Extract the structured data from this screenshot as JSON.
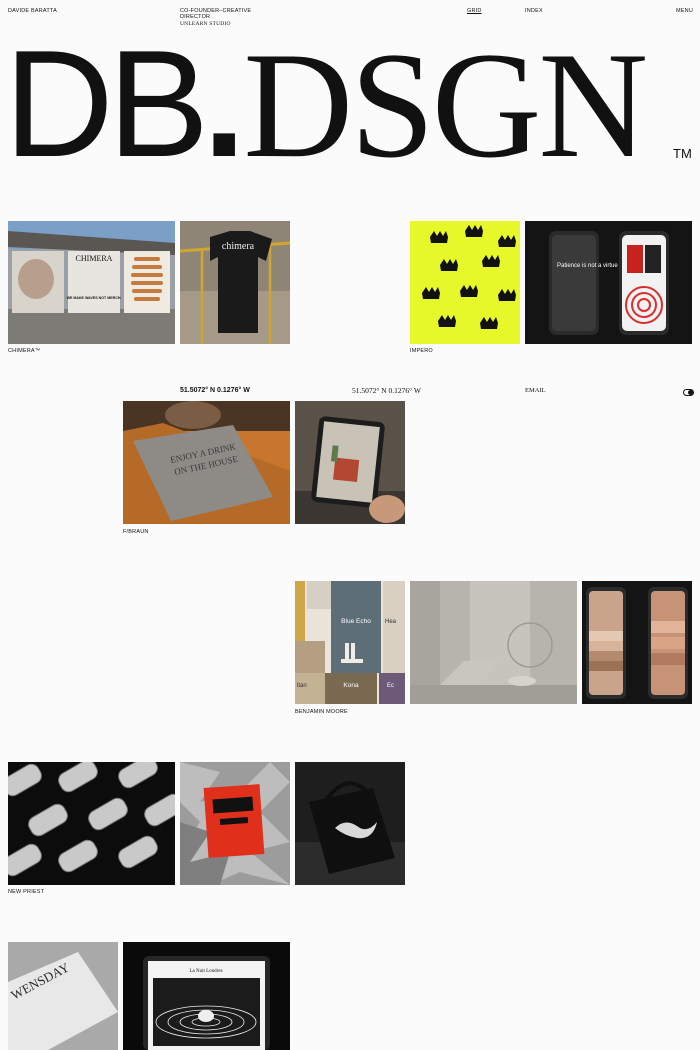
{
  "header": {
    "name": "DAVIDE BARATTA",
    "role_line1": "CO-FOUNDER–CREATIVE",
    "role_line2": "DIRECTOR",
    "studio": "UNLEARN STUDIO",
    "nav": {
      "grid": "GRID",
      "index": "INDEX",
      "menu": "MENU"
    }
  },
  "logo": {
    "part1": "DB",
    "dot": ".",
    "part2": "DSGN",
    "tm": "TM"
  },
  "location": {
    "coords_bold": "51.5072° N  0.1276° W",
    "coords_serif": "51.5072° N  0.1276° W",
    "email": "EMAIL"
  },
  "projects": [
    {
      "caption": "CHIMERA™"
    },
    {
      "caption": "IMPERO"
    },
    {
      "caption": "F/BRAUN"
    },
    {
      "caption": "BENJAMIN MOORE"
    },
    {
      "caption": "NEW PRIEST"
    }
  ],
  "image_text": {
    "chimera_sign": "CHIMERA",
    "chimera_merch": "WE MAKE WAVES NOT MERCH.",
    "chimera_tee": "chimera",
    "impero_phone": "Patience is not a virtue",
    "fbraun_card_1": "ENJOY A DRINK",
    "fbraun_card_2": "ON THE HOUSE",
    "bm_card_1": "Blue Echo",
    "bm_card_2": "Kona",
    "bm_card_3": "Hea",
    "bm_card_4": "Ec",
    "bm_card_5": "ltan",
    "wensday": "WENSDAY",
    "tablet_title": "La Nuit Londres"
  },
  "colors": {
    "background": "#fbfbfb",
    "impero_yellow": "#e6f82a",
    "fbraun_orange": "#c8762e",
    "newpriest_red": "#e0301c"
  }
}
